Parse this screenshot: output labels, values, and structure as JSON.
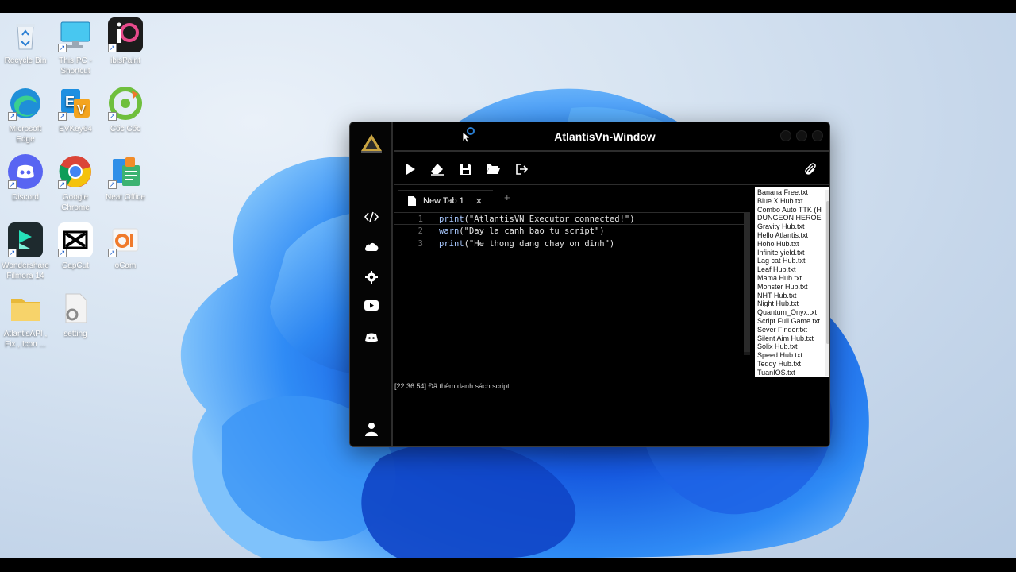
{
  "desktop": {
    "icons": [
      {
        "label": "Recycle Bin",
        "icon": "recycle-bin-icon"
      },
      {
        "label": "This PC - Shortcut",
        "icon": "this-pc-icon"
      },
      {
        "label": "ibisPaint",
        "icon": "ibispaint-icon"
      },
      {
        "label": "Microsoft Edge",
        "icon": "edge-icon"
      },
      {
        "label": "EVKey64",
        "icon": "evkey-icon"
      },
      {
        "label": "Cốc Cốc",
        "icon": "coccoc-icon"
      },
      {
        "label": "Discord",
        "icon": "discord-icon"
      },
      {
        "label": "Google Chrome",
        "icon": "chrome-icon"
      },
      {
        "label": "Neat Office",
        "icon": "neat-office-icon"
      },
      {
        "label": "Wondershare Filmora 14",
        "icon": "filmora-icon"
      },
      {
        "label": "CapCut",
        "icon": "capcut-icon"
      },
      {
        "label": "oCam",
        "icon": "ocam-icon"
      },
      {
        "label": "AtlantisAPI , Fix , Icon ...",
        "icon": "folder-icon"
      },
      {
        "label": "setting",
        "icon": "settings-file-icon"
      }
    ]
  },
  "app": {
    "title": "AtlantisVn-Window",
    "sidebar": [
      "code-icon",
      "cloud-icon",
      "gear-icon",
      "youtube-icon",
      "discord-icon",
      "user-icon"
    ],
    "toolbar": [
      "play-icon",
      "eraser-icon",
      "save-icon",
      "folder-open-icon",
      "exit-icon",
      "paperclip-icon"
    ],
    "tab": {
      "label": "New Tab 1",
      "close": "✕",
      "add": "+"
    },
    "editor": {
      "lines": [
        {
          "num": "1",
          "fn": "print",
          "arg": "(\"AtlantisVN Executor connected!\")"
        },
        {
          "num": "2",
          "fn": "warn",
          "arg": "(\"Day la canh bao tu script\")"
        },
        {
          "num": "3",
          "fn": "print",
          "arg": "(\"He thong dang chay on dinh\")"
        }
      ]
    },
    "scripts": [
      "Banana Free.txt",
      "Blue X Hub.txt",
      "Combo Auto TTK (H",
      "DUNGEON HEROE",
      "Gravity Hub.txt",
      "Hello Atlantis.txt",
      "Hoho Hub.txt",
      "Infinite yield.txt",
      "Lag cat Hub.txt",
      "Leaf Hub.txt",
      "Mama Hub.txt",
      "Monster Hub.txt",
      "NHT Hub.txt",
      "Night Hub.txt",
      "Quantum_Onyx.txt",
      "Script Full Game.txt",
      "Sever Finder.txt",
      "Silent Aim Hub.txt",
      "Solix Hub.txt",
      "Speed Hub.txt",
      "Teddy Hub.txt",
      "TuanIOS.txt"
    ],
    "console": "[22:36:54] Đã thêm danh sách script."
  }
}
